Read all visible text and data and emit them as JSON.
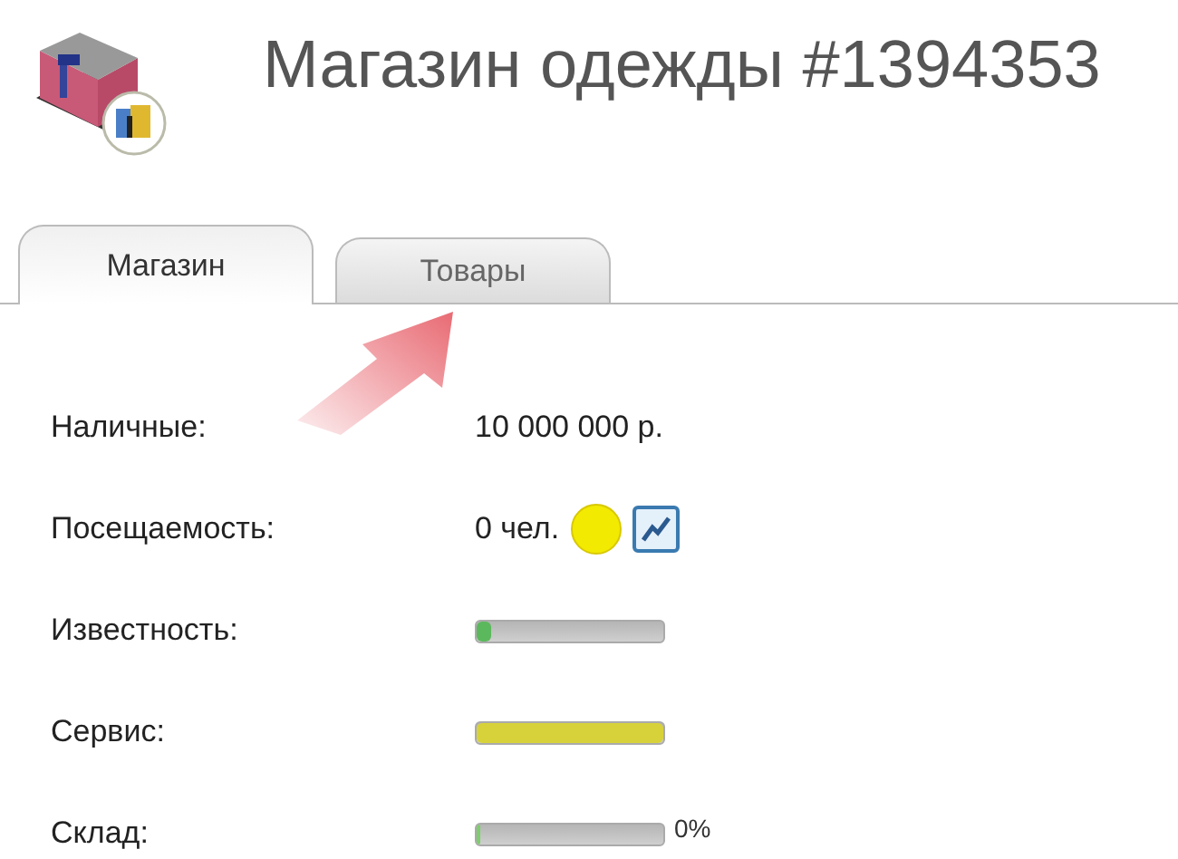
{
  "header": {
    "title": "Магазин одежды #1394353"
  },
  "tabs": [
    {
      "label": "Магазин",
      "selected": true
    },
    {
      "label": "Товары",
      "selected": false
    }
  ],
  "rows": [
    {
      "kind": "text",
      "label": "Наличные:",
      "value": "10 000 000 р."
    },
    {
      "kind": "visitors",
      "label": "Посещаемость:",
      "value": "0 чел.",
      "color": "#f2ea00"
    },
    {
      "kind": "bar",
      "label": "Известность:",
      "level": 0.08,
      "color": "#5cb85c"
    },
    {
      "kind": "bar",
      "label": "Сервис:",
      "level": 1,
      "color": "#d8d23a"
    },
    {
      "kind": "bar",
      "label": "Склад:",
      "level": 0,
      "color": "#7ccf6a",
      "reading": "0%"
    }
  ]
}
